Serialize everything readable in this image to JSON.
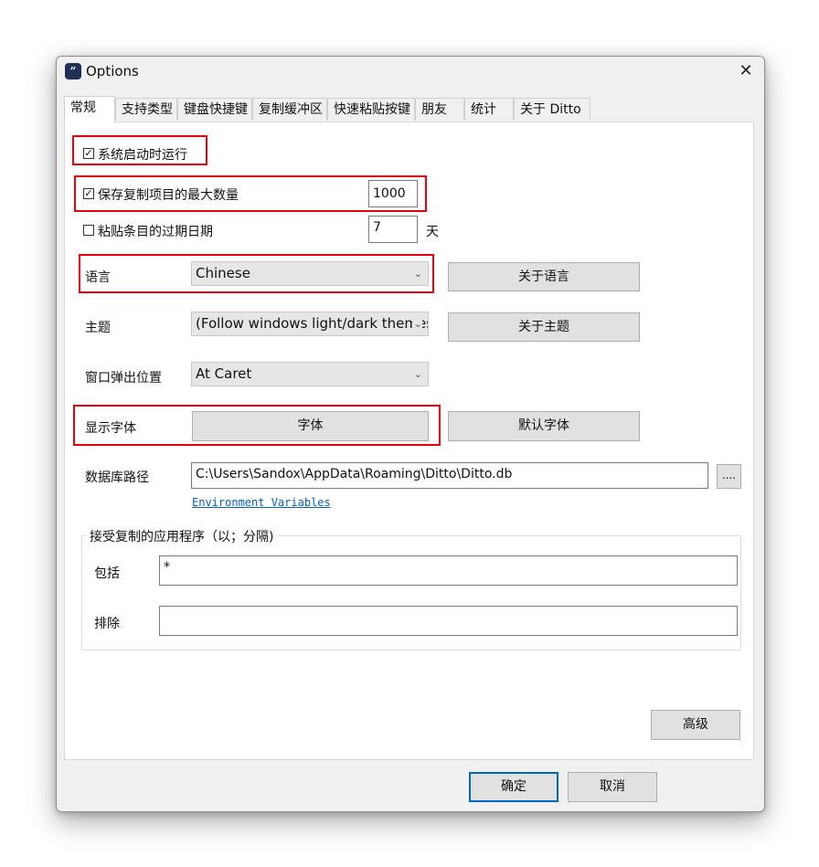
{
  "window": {
    "title": "Options",
    "icon_glyph": "”",
    "close_glyph": "✕"
  },
  "tabs": [
    {
      "label": "常规",
      "active": true
    },
    {
      "label": "支持类型"
    },
    {
      "label": "键盘快捷键"
    },
    {
      "label": "复制缓冲区"
    },
    {
      "label": "快速粘贴按键"
    },
    {
      "label": "朋友"
    },
    {
      "label": "统计"
    },
    {
      "label": "关于 Ditto"
    }
  ],
  "general": {
    "run_on_startup": {
      "label": "系统启动时运行",
      "checked": true,
      "mark": "✓"
    },
    "max_saved": {
      "label": "保存复制项目的最大数量",
      "checked": true,
      "mark": "✓",
      "value": "1000"
    },
    "expire": {
      "label": "粘贴条目的过期日期",
      "checked": false,
      "value": "7",
      "unit": "天"
    },
    "language": {
      "label": "语言",
      "value": "Chinese",
      "button": "关于语言"
    },
    "theme": {
      "label": "主题",
      "value": "(Follow windows light/dark themes)",
      "button": "关于主题"
    },
    "popup_position": {
      "label": "窗口弹出位置",
      "value": "At Caret"
    },
    "font": {
      "label": "显示字体",
      "button": "字体",
      "default_button": "默认字体"
    },
    "db_path": {
      "label": "数据库路径",
      "value": "C:\\Users\\Sandox\\AppData\\Roaming\\Ditto\\Ditto.db",
      "browse_button": "...."
    },
    "env_link": "Environment Variables",
    "accepted_apps": {
      "title": "接受复制的应用程序（以；分隔)",
      "include_label": "包括",
      "include_value": "*",
      "exclude_label": "排除",
      "exclude_value": ""
    },
    "advanced_button": "高级"
  },
  "footer": {
    "ok_button": "确定",
    "cancel_button": "取消"
  },
  "colors": {
    "highlight": "#e4000f",
    "default_button_border": "#0067c0",
    "link": "#0b5fb4"
  },
  "icons": {
    "combo_arrow": "⌄"
  }
}
